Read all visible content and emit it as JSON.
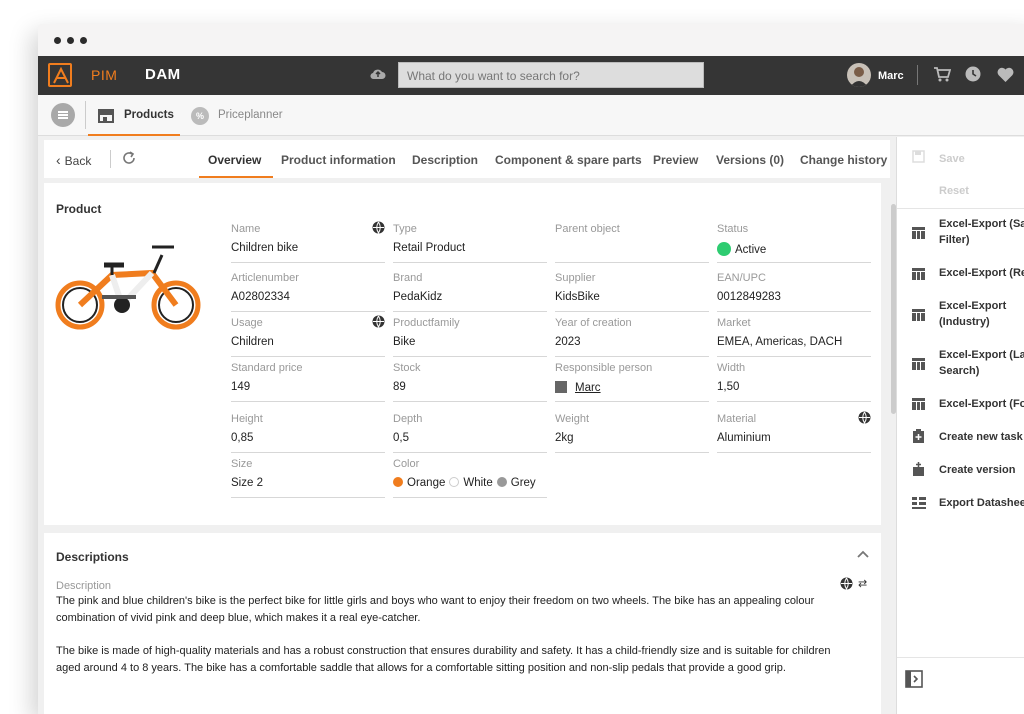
{
  "app": {
    "nav_pim": "PIM",
    "nav_dam": "DAM",
    "search_placeholder": "What do you want to search for?",
    "user": "Marc"
  },
  "modules": [
    {
      "label": "Products",
      "active": true
    },
    {
      "label": "Priceplanner",
      "active": false
    }
  ],
  "toolbar": {
    "back": "Back"
  },
  "tabs": [
    "Overview",
    "Product information",
    "Description",
    "Component & spare parts",
    "Preview",
    "Versions (0)",
    "Change history"
  ],
  "product": {
    "section_title": "Product",
    "fields": [
      {
        "label": "Name",
        "value": "Children bike",
        "globe": true
      },
      {
        "label": "Type",
        "value": "Retail Product"
      },
      {
        "label": "Parent object",
        "value": ""
      },
      {
        "label": "Status",
        "value": "Active"
      },
      {
        "label": "Articlenumber",
        "value": "A02802334"
      },
      {
        "label": "Brand",
        "value": "PedaKidz"
      },
      {
        "label": "Supplier",
        "value": "KidsBike"
      },
      {
        "label": "EAN/UPC",
        "value": "0012849283"
      },
      {
        "label": "Usage",
        "value": "Children",
        "globe": true
      },
      {
        "label": "Productfamily",
        "value": "Bike"
      },
      {
        "label": "Year of creation",
        "value": "2023"
      },
      {
        "label": "Market",
        "value": "EMEA,  Americas,  DACH"
      },
      {
        "label": "Standard price",
        "value": "149"
      },
      {
        "label": "Stock",
        "value": "89"
      },
      {
        "label": "Responsible person",
        "value": "Marc"
      },
      {
        "label": "Width",
        "value": "1,50"
      },
      {
        "label": "Height",
        "value": "0,85"
      },
      {
        "label": "Depth",
        "value": "0,5"
      },
      {
        "label": "Weight",
        "value": "2kg"
      },
      {
        "label": "Material",
        "value": "Aluminium",
        "globe": true
      },
      {
        "label": "Size",
        "value": "Size 2"
      },
      {
        "label": "Color",
        "value": ""
      }
    ],
    "colors": [
      {
        "name": "Orange",
        "hex": "#f07d1e"
      },
      {
        "name": "White",
        "hex": "#ffffff"
      },
      {
        "name": "Grey",
        "hex": "#999999"
      }
    ],
    "status_color": "#2ecc71"
  },
  "descriptions": {
    "section_title": "Descriptions",
    "label": "Description",
    "para1": "The pink and blue children's bike is the perfect bike for little girls and boys who want to enjoy their freedom on two wheels. The bike has an appealing colour combination of vivid pink and deep blue, which makes it a real eye-catcher.",
    "para2": "The bike is made of high-quality materials and has a robust construction that ensures durability and safety. It has a child-friendly size and is suitable for children aged around 4 to 8 years. The bike has a comfortable saddle that allows for a comfortable sitting position and non-slip pedals that provide a good grip."
  },
  "actions": {
    "save": "Save",
    "reset": "Reset",
    "items": [
      "Excel-Export (Sav",
      "Filter)",
      "Excel-Export (Ret",
      "Excel-Export",
      "(Industry)",
      "Excel-Export (Las",
      "Search)",
      "Excel-Export (Foo",
      "Create new task",
      "Create version",
      "Export Datasheet"
    ]
  },
  "accent": "#f07d1e"
}
